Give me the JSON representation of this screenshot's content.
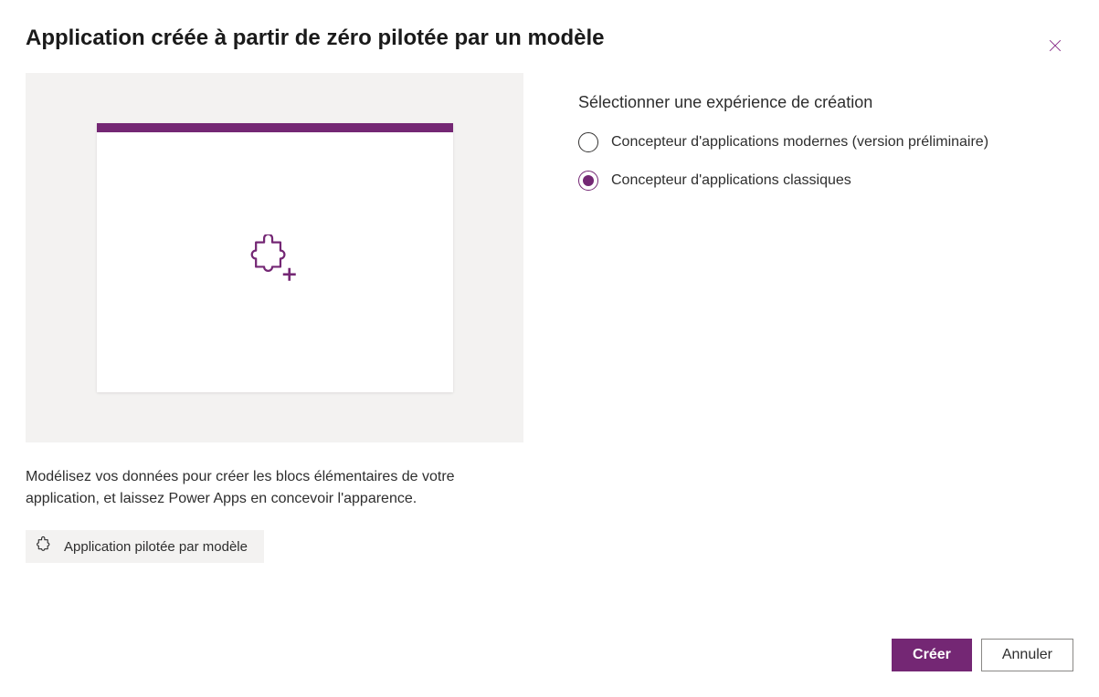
{
  "dialog": {
    "title": "Application créée à partir de zéro pilotée par un modèle",
    "description": "Modélisez vos données pour créer les blocs élémentaires de votre application, et laissez Power Apps en concevoir l'apparence.",
    "tag_label": "Application pilotée par modèle"
  },
  "experience": {
    "heading": "Sélectionner une expérience de création",
    "options": [
      {
        "label": "Concepteur d'applications modernes (version préliminaire)",
        "selected": false
      },
      {
        "label": "Concepteur d'applications classiques",
        "selected": true
      }
    ]
  },
  "footer": {
    "create_label": "Créer",
    "cancel_label": "Annuler"
  }
}
